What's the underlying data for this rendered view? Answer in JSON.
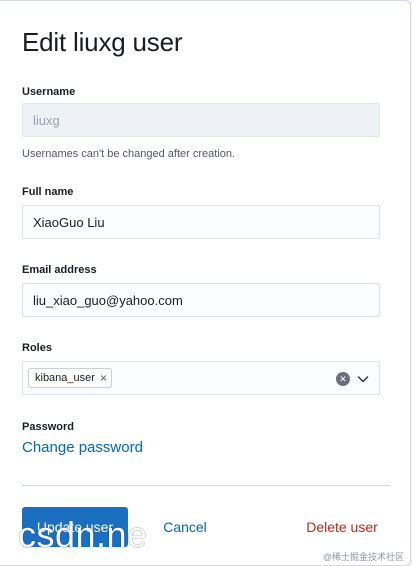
{
  "header": {
    "title": "Edit liuxg user"
  },
  "form": {
    "username": {
      "label": "Username",
      "value": "liuxg",
      "help": "Usernames can't be changed after creation."
    },
    "full_name": {
      "label": "Full name",
      "value": "XiaoGuo Liu"
    },
    "email": {
      "label": "Email address",
      "value": "liu_xiao_guo@yahoo.com"
    },
    "roles": {
      "label": "Roles",
      "selected": [
        "kibana_user"
      ],
      "remove_glyph": "×",
      "clear_icon": "clear-circle-icon",
      "expand_icon": "chevron-down-icon"
    },
    "password": {
      "label": "Password",
      "link": "Change password"
    }
  },
  "actions": {
    "update": "Update user",
    "cancel": "Cancel",
    "delete": "Delete user"
  },
  "watermarks": {
    "left": "csdn.ne",
    "right": "@稀土掘金技术社区"
  },
  "colors": {
    "primary": "#1a6fc0",
    "link": "#0067b8",
    "danger": "#bd271e",
    "disabled_field": "#eef2f7"
  }
}
